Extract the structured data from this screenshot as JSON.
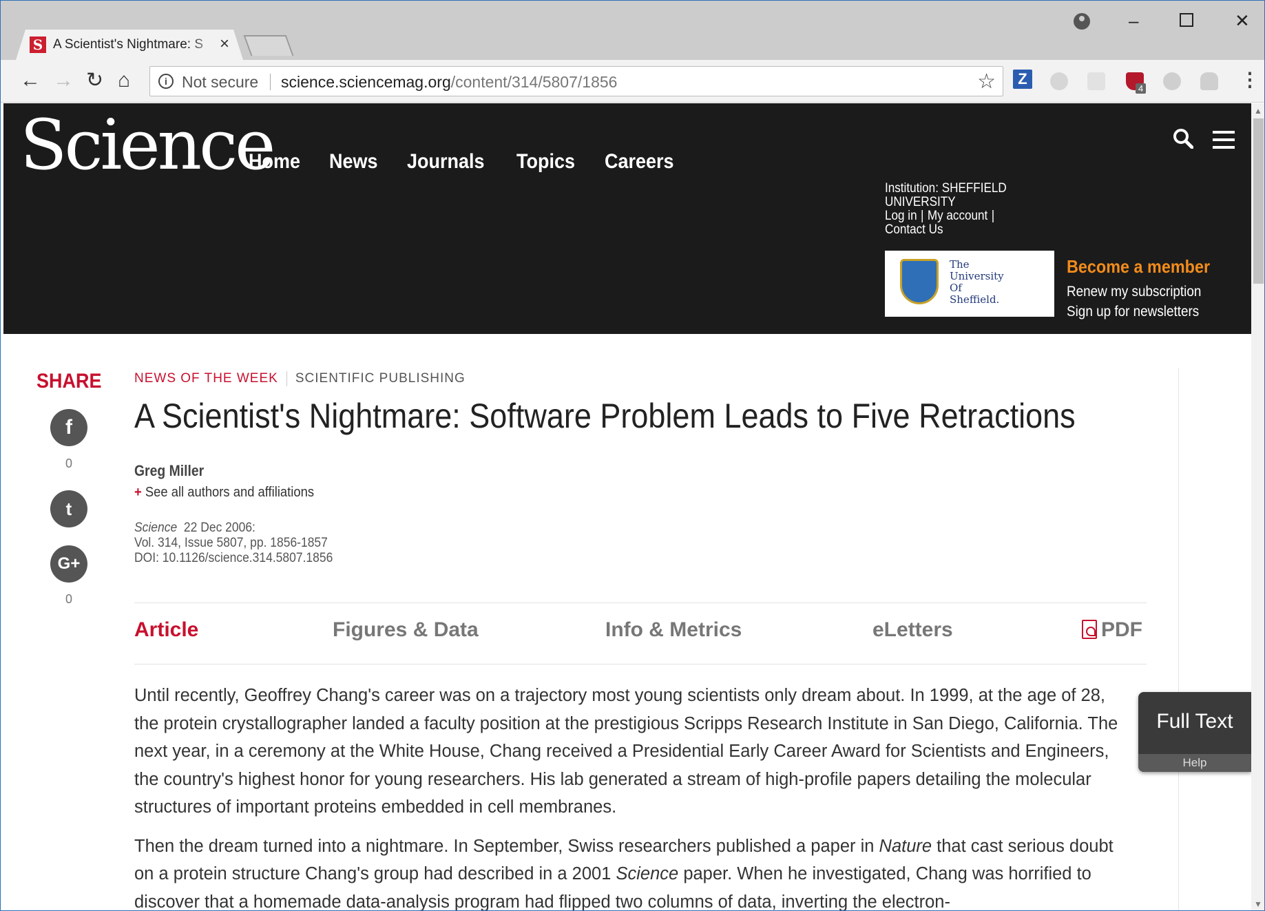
{
  "browser": {
    "tab_title": "A Scientist's Nightmare: S",
    "tab_favicon": "S",
    "security_label": "Not secure",
    "url_host": "science.sciencemag.org",
    "url_path": "/content/314/5807/1856",
    "extension_badge": "4",
    "icons": [
      "back-icon",
      "forward-icon",
      "reload-icon",
      "home-icon",
      "info-icon",
      "star-icon",
      "menu-kebab-icon"
    ]
  },
  "header": {
    "logo": "Science",
    "nav": [
      "Home",
      "News",
      "Journals",
      "Topics",
      "Careers"
    ],
    "institution": "Institution: SHEFFIELD UNIVERSITY",
    "login": "Log in",
    "my_account": "My account",
    "contact": "Contact Us",
    "university_logo_text": [
      "The",
      "University",
      "Of",
      "Sheffield."
    ],
    "become_member": "Become a member",
    "renew": "Renew my subscription",
    "newsletter": "Sign up for newsletters"
  },
  "share": {
    "label": "SHARE",
    "facebook_count": "0",
    "googleplus_count": "0"
  },
  "article": {
    "section": "NEWS OF THE WEEK",
    "topic": "SCIENTIFIC PUBLISHING",
    "title": "A Scientist's Nightmare: Software Problem Leads to Five Retractions",
    "author": "Greg Miller",
    "see_all": "See all authors and affiliations",
    "journal": "Science",
    "date": "22 Dec 2006:",
    "volume": "Vol. 314, Issue 5807, pp. 1856-1857",
    "doi": "DOI: 10.1126/science.314.5807.1856",
    "tabs": {
      "article": "Article",
      "figures": "Figures & Data",
      "info": "Info & Metrics",
      "eletters": "eLetters",
      "pdf": "PDF"
    },
    "para1": "Until recently, Geoffrey Chang's career was on a trajectory most young scientists only dream about. In 1999, at the age of 28, the protein crystallographer landed a faculty position at the prestigious Scripps Research Institute in San Diego, California. The next year, in a ceremony at the White House, Chang received a Presidential Early Career Award for Scientists and Engineers, the country's highest honor for young researchers. His lab generated a stream of high-profile papers detailing the molecular structures of important proteins embedded in cell membranes.",
    "para2_a": "Then the dream turned into a nightmare. In September, Swiss researchers published a paper in ",
    "para2_nature": "Nature",
    "para2_b": " that cast serious doubt on a protein structure Chang's group had described in a 2001 ",
    "para2_science": "Science",
    "para2_c": " paper. When he investigated, Chang was horrified to discover that a homemade data-analysis program had flipped two columns of data, inverting the electron-"
  },
  "widget": {
    "full_text": "Full Text",
    "help": "Help"
  }
}
